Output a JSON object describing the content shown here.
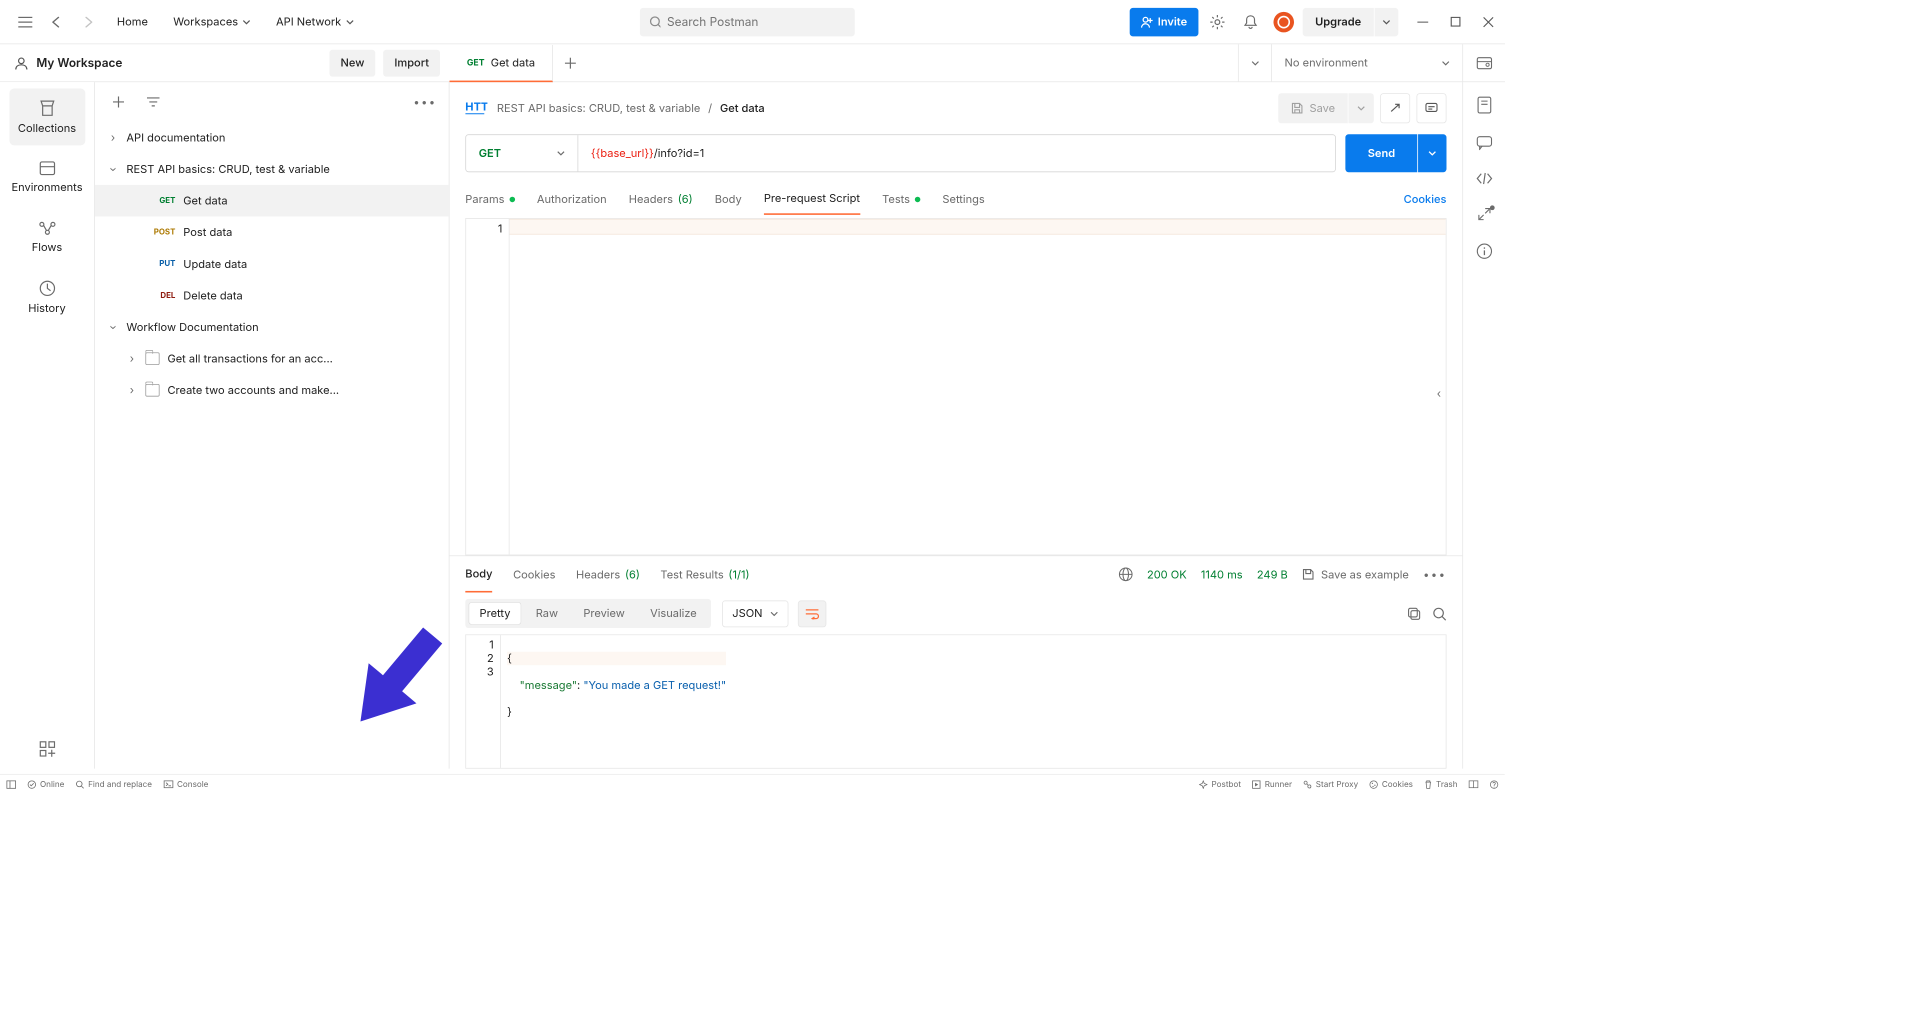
{
  "toolbar": {
    "home": "Home",
    "workspaces": "Workspaces",
    "api_network": "API Network",
    "search_placeholder": "Search Postman",
    "invite": "Invite",
    "upgrade": "Upgrade"
  },
  "workspace": {
    "title": "My Workspace",
    "new": "New",
    "import": "Import"
  },
  "rail": {
    "collections": "Collections",
    "environments": "Environments",
    "flows": "Flows",
    "history": "History"
  },
  "tree": {
    "r0": "API documentation",
    "r1": "REST API basics: CRUD, test & variable",
    "r1a_m": "GET",
    "r1a": "Get data",
    "r1b_m": "POST",
    "r1b": "Post data",
    "r1c_m": "PUT",
    "r1c": "Update data",
    "r1d_m": "DEL",
    "r1d": "Delete data",
    "r2": "Workflow Documentation",
    "r2a": "Get all transactions for an acc...",
    "r2b": "Create two accounts and make..."
  },
  "tabs": {
    "t0_method": "GET",
    "t0_label": "Get data",
    "env_label": "No environment"
  },
  "request": {
    "crumb_parent": "REST API basics: CRUD, test & variable",
    "crumb_current": "Get data",
    "save": "Save",
    "method": "GET",
    "url_var": "{{base_url}}",
    "url_rest": "/info?id=1",
    "send": "Send",
    "tabs": {
      "params": "Params",
      "auth": "Authorization",
      "headers": "Headers",
      "headers_count": "(6)",
      "body": "Body",
      "prereq": "Pre-request Script",
      "tests": "Tests",
      "settings": "Settings",
      "cookies": "Cookies"
    },
    "editor_line": "1"
  },
  "response": {
    "tabs": {
      "body": "Body",
      "cookies": "Cookies",
      "headers": "Headers",
      "headers_count": "(6)",
      "tests": "Test Results",
      "tests_count": "(1/1)"
    },
    "status": "200 OK",
    "time": "1140 ms",
    "size": "249 B",
    "save_example": "Save as example",
    "view": {
      "pretty": "Pretty",
      "raw": "Raw",
      "preview": "Preview",
      "visualize": "Visualize",
      "format": "JSON"
    },
    "lines": {
      "l1": "1",
      "l2": "2",
      "l3": "3"
    },
    "code": {
      "brace_open": "{",
      "key": "\"message\"",
      "colon": ": ",
      "val": "\"You made a GET request!\"",
      "brace_close": "}"
    }
  },
  "bottom": {
    "online": "Online",
    "find": "Find and replace",
    "console": "Console",
    "postbot": "Postbot",
    "runner": "Runner",
    "proxy": "Start Proxy",
    "cookies": "Cookies",
    "trash": "Trash"
  }
}
